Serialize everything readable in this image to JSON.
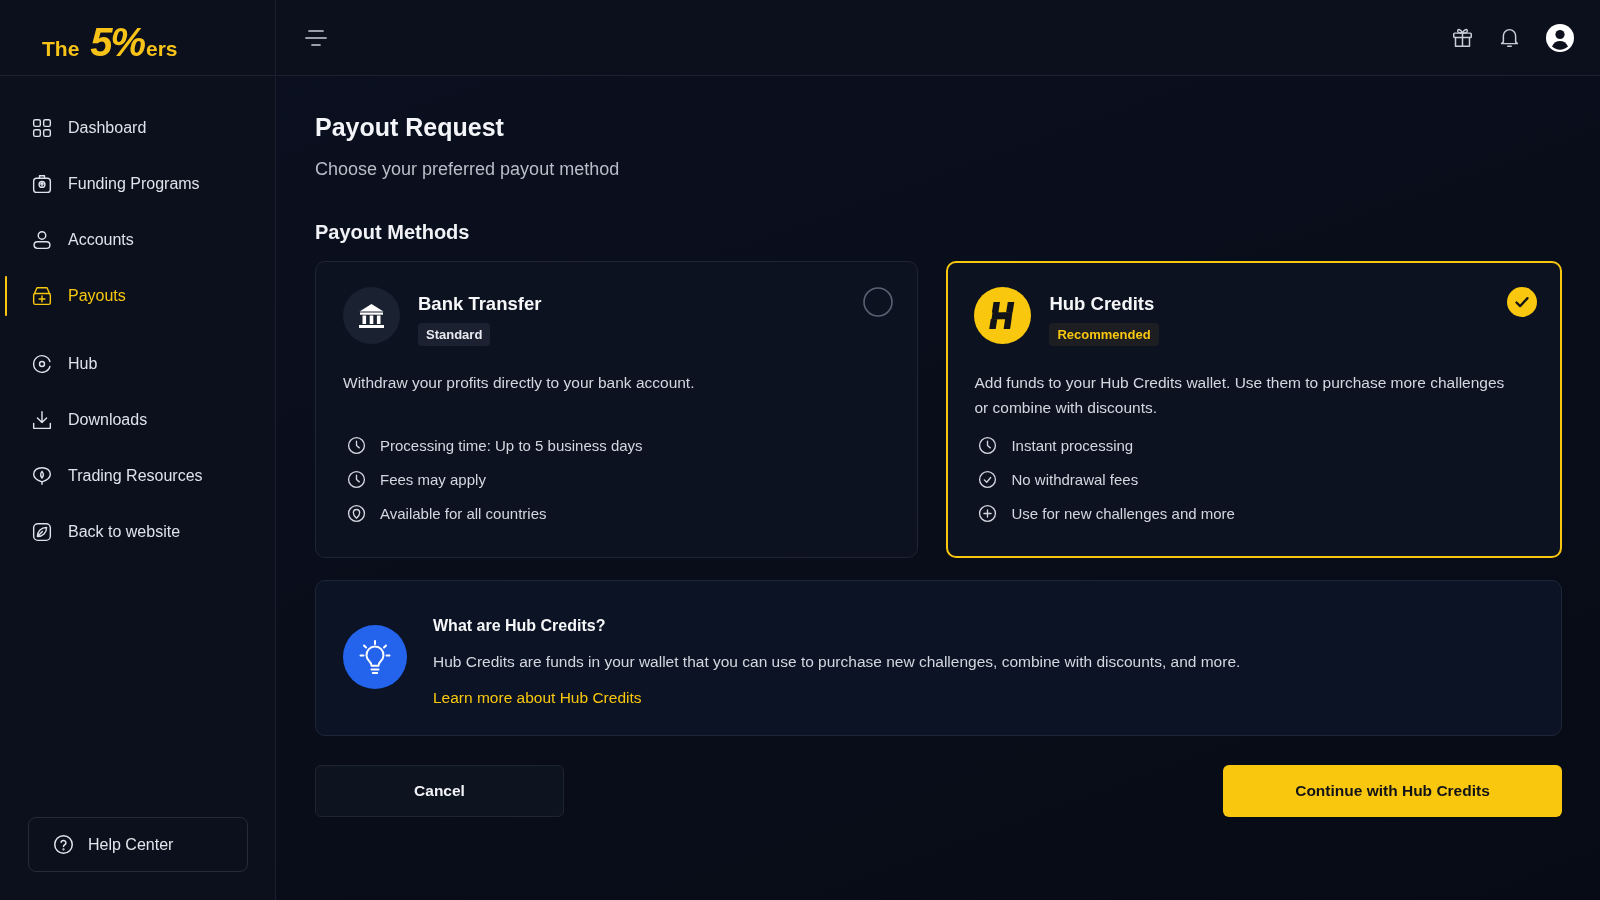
{
  "logo": {
    "text": "The **5%**ers"
  },
  "sidebar": {
    "items": [
      {
        "label": "Dashboard",
        "selected": false
      },
      {
        "label": "Funding Programs",
        "selected": false
      },
      {
        "label": "Accounts",
        "selected": false
      },
      {
        "label": "Payouts",
        "selected": true
      },
      {
        "label": "Hub",
        "selected": false
      },
      {
        "label": "Downloads",
        "selected": false
      },
      {
        "label": "Trading Resources",
        "selected": false
      },
      {
        "label": "Back to website",
        "selected": false
      }
    ],
    "help": {
      "label": "Help Center"
    }
  },
  "page": {
    "title": "Payout Request",
    "subtitle": "Choose your preferred payout method"
  },
  "methods": {
    "heading": "Payout Methods",
    "items": [
      {
        "kind": "bank",
        "title": "Bank Transfer",
        "badge": "Standard",
        "description": "Withdraw your profits directly to your bank account.",
        "selected": false,
        "features": [
          "Processing time: Up to 5 business days",
          "Fees may apply",
          "Available for all countries"
        ]
      },
      {
        "kind": "hub",
        "title": "Hub Credits",
        "badge": "Recommended",
        "description": "Add funds to your Hub Credits wallet. Use them to purchase more challenges or combine with discounts.",
        "selected": true,
        "features": [
          "Instant processing",
          "No withdrawal fees",
          "Use for new challenges and more"
        ]
      }
    ]
  },
  "info": {
    "title": "What are Hub Credits?",
    "body": "Hub Credits are funds in your wallet that you can use to purchase new challenges, combine with discounts, and more.",
    "link": "Learn more about Hub Credits"
  },
  "actions": {
    "cancel": "Cancel",
    "confirm": "Continue with Hub Credits"
  }
}
